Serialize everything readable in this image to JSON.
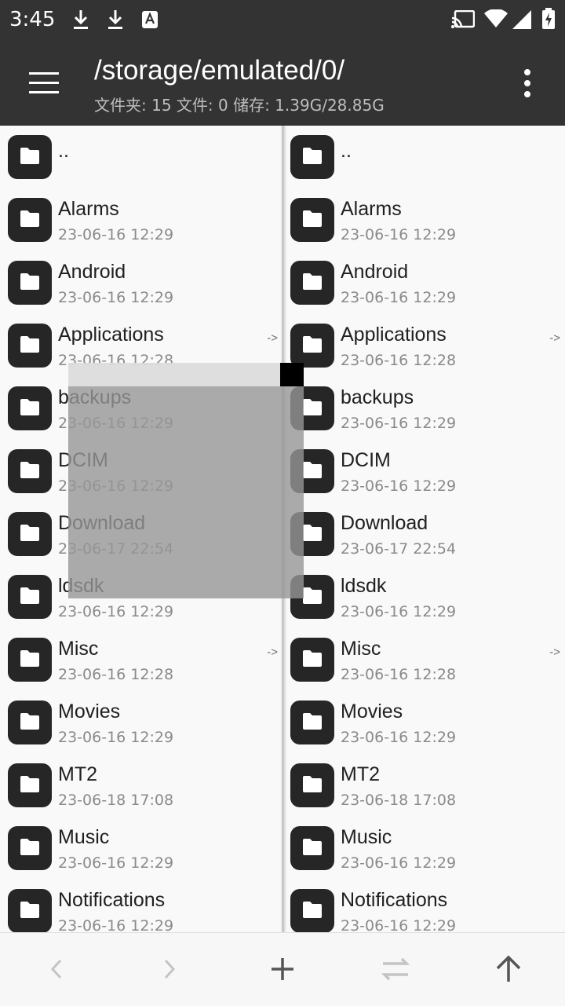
{
  "status_bar": {
    "time": "3:45",
    "left_icons": [
      "download-icon",
      "download-icon",
      "keyboard-a-icon"
    ],
    "right_icons": [
      "cast-icon",
      "wifi-icon",
      "signal-icon",
      "battery-icon"
    ]
  },
  "toolbar": {
    "path": "/storage/emulated/0/",
    "summary": "文件夹: 15  文件: 0  储存: 1.39G/28.85G"
  },
  "link_marker": "->",
  "up_dir": "..",
  "files": [
    {
      "name": "Alarms",
      "date": "23-06-16 12:29",
      "link": false
    },
    {
      "name": "Android",
      "date": "23-06-16 12:29",
      "link": false
    },
    {
      "name": "Applications",
      "date": "23-06-16 12:28",
      "link": true
    },
    {
      "name": "backups",
      "date": "23-06-16 12:29",
      "link": false
    },
    {
      "name": "DCIM",
      "date": "23-06-16 12:29",
      "link": false
    },
    {
      "name": "Download",
      "date": "23-06-17 22:54",
      "link": false
    },
    {
      "name": "ldsdk",
      "date": "23-06-16 12:29",
      "link": false
    },
    {
      "name": "Misc",
      "date": "23-06-16 12:28",
      "link": true
    },
    {
      "name": "Movies",
      "date": "23-06-16 12:29",
      "link": false
    },
    {
      "name": "MT2",
      "date": "23-06-18 17:08",
      "link": false
    },
    {
      "name": "Music",
      "date": "23-06-16 12:29",
      "link": false
    },
    {
      "name": "Notifications",
      "date": "23-06-16 12:29",
      "link": false
    }
  ],
  "bottom_bar": {
    "buttons": [
      "back-icon",
      "forward-icon",
      "add-icon",
      "swap-icon",
      "up-icon"
    ]
  },
  "colors": {
    "header": "#333333",
    "folder_icon": "#262626",
    "disabled_icon": "#c4c4c4",
    "active_icon": "#555555"
  }
}
